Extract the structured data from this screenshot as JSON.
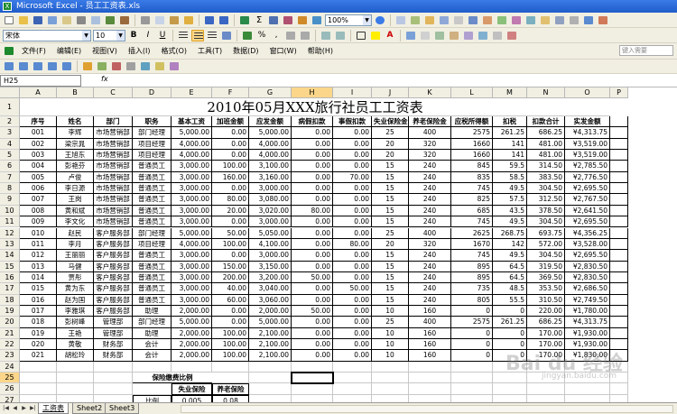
{
  "window": {
    "title": "Microsoft Excel - 员工工资表.xls"
  },
  "toolbar1": {
    "zoom": "100%"
  },
  "toolbar2": {
    "font_name": "宋体",
    "font_size": "10"
  },
  "menu": [
    "文件(F)",
    "编辑(E)",
    "视图(V)",
    "插入(I)",
    "格式(O)",
    "工具(T)",
    "数据(D)",
    "窗口(W)",
    "帮助(H)"
  ],
  "help_placeholder": "键入需要",
  "formula": {
    "name_box": "H25",
    "fx": "fx",
    "content": ""
  },
  "columns": [
    "A",
    "B",
    "C",
    "D",
    "E",
    "F",
    "G",
    "H",
    "I",
    "J",
    "K",
    "L",
    "M",
    "N",
    "O",
    "P"
  ],
  "selected_column": "H",
  "selected_row": "25",
  "sheet_title": "2010年05月XXX旅行社员工工资表",
  "headers": [
    "序号",
    "姓名",
    "部门",
    "职务",
    "基本工资",
    "加班金额",
    "应发金额",
    "病假扣款",
    "事假扣款",
    "失业保险金",
    "养老保险金",
    "应税所得额",
    "扣税",
    "扣款合计",
    "实发金额"
  ],
  "rows": [
    [
      "001",
      "李辉",
      "市场营销部",
      "部门经理",
      "5,000.00",
      "0.00",
      "5,000.00",
      "0.00",
      "0.00",
      "25",
      "400",
      "2575",
      "261.25",
      "686.25",
      "¥4,313.75"
    ],
    [
      "002",
      "梁宗晁",
      "市场营销部",
      "项目经理",
      "4,000.00",
      "0.00",
      "4,000.00",
      "0.00",
      "0.00",
      "20",
      "320",
      "1660",
      "141",
      "481.00",
      "¥3,519.00"
    ],
    [
      "003",
      "王旭东",
      "市场营销部",
      "项目经理",
      "4,000.00",
      "0.00",
      "4,000.00",
      "0.00",
      "0.00",
      "20",
      "320",
      "1660",
      "141",
      "481.00",
      "¥3,519.00"
    ],
    [
      "004",
      "彭艳芬",
      "市场营销部",
      "普通员工",
      "3,000.00",
      "100.00",
      "3,100.00",
      "0.00",
      "0.00",
      "15",
      "240",
      "845",
      "59.5",
      "314.50",
      "¥2,785.50"
    ],
    [
      "005",
      "卢俊",
      "市场营销部",
      "普通员工",
      "3,000.00",
      "160.00",
      "3,160.00",
      "0.00",
      "70.00",
      "15",
      "240",
      "835",
      "58.5",
      "383.50",
      "¥2,776.50"
    ],
    [
      "006",
      "李日源",
      "市场营销部",
      "普通员工",
      "3,000.00",
      "0.00",
      "3,000.00",
      "0.00",
      "0.00",
      "15",
      "240",
      "745",
      "49.5",
      "304.50",
      "¥2,695.50"
    ],
    [
      "007",
      "王岗",
      "市场营销部",
      "普通员工",
      "3,000.00",
      "80.00",
      "3,080.00",
      "0.00",
      "0.00",
      "15",
      "240",
      "825",
      "57.5",
      "312.50",
      "¥2,767.50"
    ],
    [
      "008",
      "黄和斌",
      "市场营销部",
      "普通员工",
      "3,000.00",
      "20.00",
      "3,020.00",
      "80.00",
      "0.00",
      "15",
      "240",
      "685",
      "43.5",
      "378.50",
      "¥2,641.50"
    ],
    [
      "009",
      "李文化",
      "市场营销部",
      "普通员工",
      "3,000.00",
      "0.00",
      "3,000.00",
      "0.00",
      "0.00",
      "15",
      "240",
      "745",
      "49.5",
      "304.50",
      "¥2,695.50"
    ],
    [
      "010",
      "赵民",
      "客户服务部",
      "部门经理",
      "5,000.00",
      "50.00",
      "5,050.00",
      "0.00",
      "0.00",
      "25",
      "400",
      "2625",
      "268.75",
      "693.75",
      "¥4,356.25"
    ],
    [
      "011",
      "李月",
      "客户服务部",
      "项目经理",
      "4,000.00",
      "100.00",
      "4,100.00",
      "0.00",
      "80.00",
      "20",
      "320",
      "1670",
      "142",
      "572.00",
      "¥3,528.00"
    ],
    [
      "012",
      "王丽丽",
      "客户服务部",
      "普通员工",
      "3,000.00",
      "0.00",
      "3,000.00",
      "0.00",
      "0.00",
      "15",
      "240",
      "745",
      "49.5",
      "304.50",
      "¥2,695.50"
    ],
    [
      "013",
      "马健",
      "客户服务部",
      "普通员工",
      "3,000.00",
      "150.00",
      "3,150.00",
      "0.00",
      "0.00",
      "15",
      "240",
      "895",
      "64.5",
      "319.50",
      "¥2,830.50"
    ],
    [
      "014",
      "贾彤",
      "客户服务部",
      "普通员工",
      "3,000.00",
      "200.00",
      "3,200.00",
      "50.00",
      "0.00",
      "15",
      "240",
      "895",
      "64.5",
      "369.50",
      "¥2,830.50"
    ],
    [
      "015",
      "黄为东",
      "客户服务部",
      "普通员工",
      "3,000.00",
      "40.00",
      "3,040.00",
      "0.00",
      "50.00",
      "15",
      "240",
      "735",
      "48.5",
      "353.50",
      "¥2,686.50"
    ],
    [
      "016",
      "赵为国",
      "客户服务部",
      "普通员工",
      "3,000.00",
      "60.00",
      "3,060.00",
      "0.00",
      "0.00",
      "15",
      "240",
      "805",
      "55.5",
      "310.50",
      "¥2,749.50"
    ],
    [
      "017",
      "李雅琪",
      "客户服务部",
      "助理",
      "2,000.00",
      "0.00",
      "2,000.00",
      "50.00",
      "0.00",
      "10",
      "160",
      "0",
      "0",
      "220.00",
      "¥1,780.00"
    ],
    [
      "018",
      "彭树峰",
      "管理部",
      "部门经理",
      "5,000.00",
      "0.00",
      "5,000.00",
      "0.00",
      "0.00",
      "25",
      "400",
      "2575",
      "261.25",
      "686.25",
      "¥4,313.75"
    ],
    [
      "019",
      "王艳",
      "管理部",
      "助理",
      "2,000.00",
      "100.00",
      "2,100.00",
      "0.00",
      "0.00",
      "10",
      "160",
      "0",
      "0",
      "170.00",
      "¥1,930.00"
    ],
    [
      "020",
      "黄敬",
      "财务部",
      "会计",
      "2,000.00",
      "100.00",
      "2,100.00",
      "0.00",
      "0.00",
      "10",
      "160",
      "0",
      "0",
      "170.00",
      "¥1,930.00"
    ],
    [
      "021",
      "胡松玲",
      "财务部",
      "会计",
      "2,000.00",
      "100.00",
      "2,100.00",
      "0.00",
      "0.00",
      "10",
      "160",
      "0",
      "0",
      "170.00",
      "¥1,830.00"
    ]
  ],
  "row_numbers": [
    "1",
    "2",
    "3",
    "4",
    "5",
    "6",
    "7",
    "8",
    "9",
    "10",
    "11",
    "12",
    "13",
    "14",
    "15",
    "16",
    "17",
    "18",
    "19",
    "20",
    "21",
    "22",
    "23",
    "24",
    "25",
    "26",
    "27"
  ],
  "insurance": {
    "title": "保险缴费比例",
    "col1": "失业保险",
    "col2": "养老保险",
    "row_label": "比例",
    "val1": "0.005",
    "val2": "0.08"
  },
  "sheet_tabs": [
    "工资表",
    "Sheet2",
    "Sheet3"
  ],
  "active_tab": "工资表",
  "watermark": "Bai du 经验",
  "watermark_sub": "jingyan.baidu.com",
  "colors": {
    "title_bar": "#1f5cc9",
    "toolbar_bg": "#f1efe2",
    "selected_header": "#fbd68a"
  }
}
